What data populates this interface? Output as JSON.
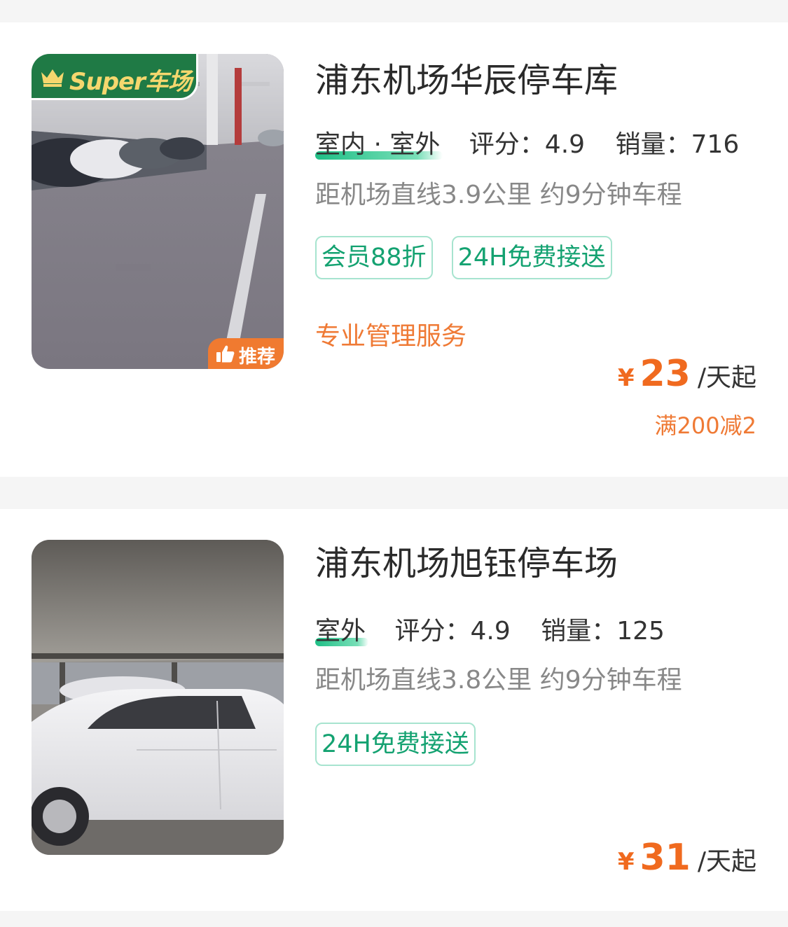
{
  "colors": {
    "accent_green": "#14a271",
    "accent_orange": "#f06a1f",
    "badge_green": "#1f7a45",
    "badge_gold": "#f5d76e",
    "background": "#f5f5f5"
  },
  "listings": [
    {
      "badge": {
        "text": "Super车场",
        "icon": "crown-icon"
      },
      "photo": "indoor-garage-photo",
      "recommend_tag": {
        "text": "推荐",
        "icon": "thumbs-up-icon"
      },
      "title": "浦东机场华辰停车库",
      "location_type": "室内 · 室外",
      "rating": "评分：4.9",
      "sales": "销量：716",
      "distance": "距机场直线3.9公里 约9分钟车程",
      "tags": [
        "会员88折",
        "24H免费接送"
      ],
      "service": "专业管理服务",
      "price": {
        "currency": "¥",
        "amount": "23",
        "unit": "/天起"
      },
      "discount": "满200减2"
    },
    {
      "photo": "covered-carport-photo",
      "title": "浦东机场旭钰停车场",
      "location_type": "室外",
      "rating": "评分：4.9",
      "sales": "销量：125",
      "distance": "距机场直线3.8公里 约9分钟车程",
      "tags": [
        "24H免费接送"
      ],
      "price": {
        "currency": "¥",
        "amount": "31",
        "unit": "/天起"
      }
    }
  ]
}
